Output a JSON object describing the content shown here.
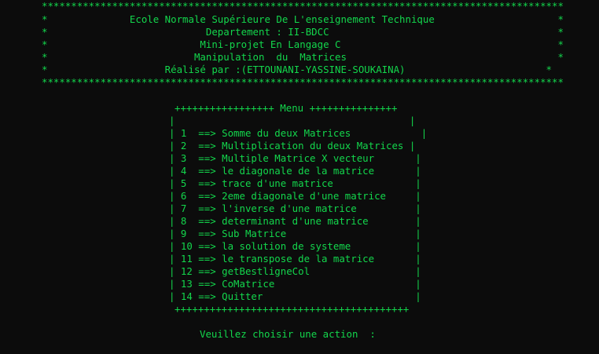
{
  "console": {
    "banner": {
      "border_top": "*****************************************************************************************",
      "rows": [
        "*              Ecole Normale Supérieure De L'enseignement Technique                     *",
        "*                           Departement : II-BDCC                                       *",
        "*                          Mini-projet En Langage C                                     *",
        "*                         Manipulation  du  Matrices                                    *",
        "*                    Réalisé par :(ETTOUNANI-YASSINE-SOUKAINA)                        *"
      ],
      "border_bottom": "*****************************************************************************************"
    },
    "menu": {
      "header": "+++++++++++++++++ Menu +++++++++++++++",
      "blank_row": "|                                        |",
      "items": [
        "| 1  ==> Somme du deux Matrices            |",
        "| 2  ==> Multiplication du deux Matrices |",
        "| 3  ==> Multiple Matrice X vecteur       |",
        "| 4  ==> le diagonale de la matrice       |",
        "| 5  ==> trace d'une matrice              |",
        "| 6  ==> 2eme diagonale d'une matrice     |",
        "| 7  ==> l'inverse d'une matrice          |",
        "| 8  ==> determinant d'une matrice        |",
        "| 9  ==> Sub Matrice                      |",
        "| 10 ==> la solution de systeme           |",
        "| 11 ==> le transpose de la matrice       |",
        "| 12 ==> getBestligneCol                  |",
        "| 13 ==> CoMatrice                        |",
        "| 14 ==> Quitter                          |"
      ],
      "footer": "++++++++++++++++++++++++++++++++++++++++"
    },
    "prompt": "Veuillez choisir une action  :"
  },
  "colors": {
    "background": "#0c0c0c",
    "text": "#13d64c"
  }
}
